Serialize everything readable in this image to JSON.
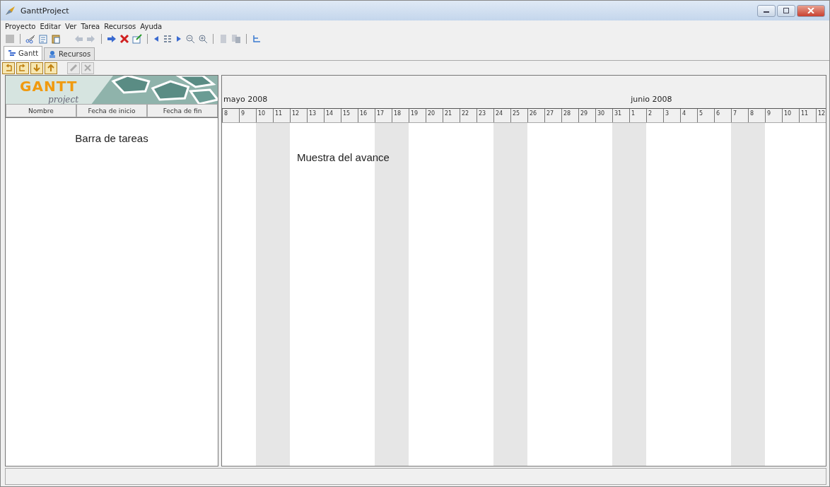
{
  "window": {
    "title": "GanttProject"
  },
  "menu": [
    "Proyecto",
    "Editar",
    "Ver",
    "Tarea",
    "Recursos",
    "Ayuda"
  ],
  "tabs": [
    {
      "label": "Gantt",
      "selected": true
    },
    {
      "label": "Recursos",
      "selected": false
    }
  ],
  "logo": {
    "main": "GANTT",
    "sub": "project"
  },
  "task_table": {
    "columns": [
      "Nombre",
      "Fecha de inicio",
      "Fecha de fin"
    ],
    "annotation": "Barra de tareas"
  },
  "timeline": {
    "months": [
      "mayo 2008",
      "junio 2008"
    ],
    "annotation": "Muestra del avance",
    "days": [
      {
        "label": "8",
        "weekend": false
      },
      {
        "label": "9",
        "weekend": false
      },
      {
        "label": "10",
        "weekend": true
      },
      {
        "label": "11",
        "weekend": true
      },
      {
        "label": "12",
        "weekend": false
      },
      {
        "label": "13",
        "weekend": false
      },
      {
        "label": "14",
        "weekend": false
      },
      {
        "label": "15",
        "weekend": false
      },
      {
        "label": "16",
        "weekend": false
      },
      {
        "label": "17",
        "weekend": true
      },
      {
        "label": "18",
        "weekend": true
      },
      {
        "label": "19",
        "weekend": false
      },
      {
        "label": "20",
        "weekend": false
      },
      {
        "label": "21",
        "weekend": false
      },
      {
        "label": "22",
        "weekend": false
      },
      {
        "label": "23",
        "weekend": false
      },
      {
        "label": "24",
        "weekend": true
      },
      {
        "label": "25",
        "weekend": true
      },
      {
        "label": "26",
        "weekend": false
      },
      {
        "label": "27",
        "weekend": false
      },
      {
        "label": "28",
        "weekend": false
      },
      {
        "label": "29",
        "weekend": false
      },
      {
        "label": "30",
        "weekend": false
      },
      {
        "label": "31",
        "weekend": true
      },
      {
        "label": "1",
        "weekend": true
      },
      {
        "label": "2",
        "weekend": false
      },
      {
        "label": "3",
        "weekend": false
      },
      {
        "label": "4",
        "weekend": false
      },
      {
        "label": "5",
        "weekend": false
      },
      {
        "label": "6",
        "weekend": false
      },
      {
        "label": "7",
        "weekend": true
      },
      {
        "label": "8",
        "weekend": true
      },
      {
        "label": "9",
        "weekend": false
      },
      {
        "label": "10",
        "weekend": false
      },
      {
        "label": "11",
        "weekend": false
      },
      {
        "label": "12",
        "weekend": false
      }
    ]
  }
}
